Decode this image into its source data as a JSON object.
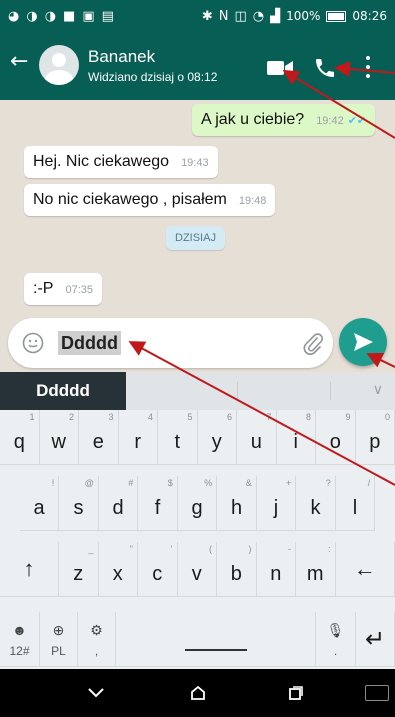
{
  "status_bar": {
    "time": "08:26",
    "battery": "100%"
  },
  "header": {
    "contact_name": "Bananek",
    "last_seen": "Widziano dzisiaj o 08:12"
  },
  "messages": [
    {
      "text": "A jak u ciebie?",
      "time": "19:42",
      "direction": "outgoing"
    },
    {
      "text": "Hej. Nic ciekawego",
      "time": "19:43",
      "direction": "incoming"
    },
    {
      "text": "No nic ciekawego , pisałem",
      "time": "19:48",
      "direction": "incoming"
    },
    {
      "text": ":-P",
      "time": "07:35",
      "direction": "incoming"
    }
  ],
  "day_divider": "DZISIAJ",
  "composer": {
    "text": "Ddddd"
  },
  "keyboard": {
    "suggestion": "Ddddd",
    "rows": [
      [
        {
          "k": "q",
          "h": "1"
        },
        {
          "k": "w",
          "h": "2"
        },
        {
          "k": "e",
          "h": "3"
        },
        {
          "k": "r",
          "h": "4"
        },
        {
          "k": "t",
          "h": "5"
        },
        {
          "k": "y",
          "h": "6"
        },
        {
          "k": "u",
          "h": "7"
        },
        {
          "k": "i",
          "h": "8"
        },
        {
          "k": "o",
          "h": "9"
        },
        {
          "k": "p",
          "h": "0"
        }
      ],
      [
        {
          "k": "a",
          "h": "!"
        },
        {
          "k": "s",
          "h": "@"
        },
        {
          "k": "d",
          "h": "#"
        },
        {
          "k": "f",
          "h": "$"
        },
        {
          "k": "g",
          "h": "%"
        },
        {
          "k": "h",
          "h": "&"
        },
        {
          "k": "j",
          "h": "+"
        },
        {
          "k": "k",
          "h": "?"
        },
        {
          "k": "l",
          "h": "/"
        }
      ],
      [
        {
          "k": "z",
          "h": "_"
        },
        {
          "k": "x",
          "h": "\""
        },
        {
          "k": "c",
          "h": "'"
        },
        {
          "k": "v",
          "h": "("
        },
        {
          "k": "b",
          "h": ")"
        },
        {
          "k": "n",
          "h": "-"
        },
        {
          "k": "m",
          "h": ":"
        }
      ]
    ],
    "symbols_label": "12#",
    "language_label": "PL",
    "comma_label": ","
  },
  "colors": {
    "header": "#075e54",
    "outgoing_bubble": "#dcf8c6",
    "send_button": "#1f9d8e",
    "annotation_arrows": "#c0181b"
  }
}
